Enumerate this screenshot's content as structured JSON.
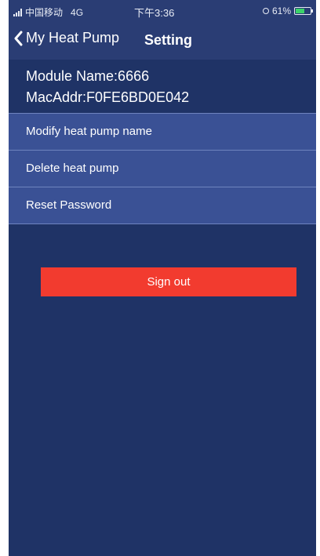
{
  "status_bar": {
    "carrier": "中国移动",
    "network": "4G",
    "time": "下午3:36",
    "battery": "61%",
    "battery_level": 0.61,
    "battery_color": "#3bd36a"
  },
  "nav": {
    "back_label": "My Heat Pump",
    "title": "Setting"
  },
  "module": {
    "name_line": "Module Name:6666",
    "mac_line": "MacAddr:F0FE6BD0E042"
  },
  "menu": {
    "items": [
      {
        "label": "Modify heat pump name"
      },
      {
        "label": "Delete heat pump"
      },
      {
        "label": "Reset Password"
      }
    ]
  },
  "actions": {
    "sign_out_label": "Sign out",
    "sign_out_color": "#f23b2f"
  },
  "icons": {
    "back": "chevron-left-icon",
    "signal": "signal-icon",
    "location": "location-icon",
    "battery": "battery-icon"
  },
  "colors": {
    "background": "#1f3366",
    "header": "#2a3d74",
    "menu_item": "#3a5195"
  }
}
